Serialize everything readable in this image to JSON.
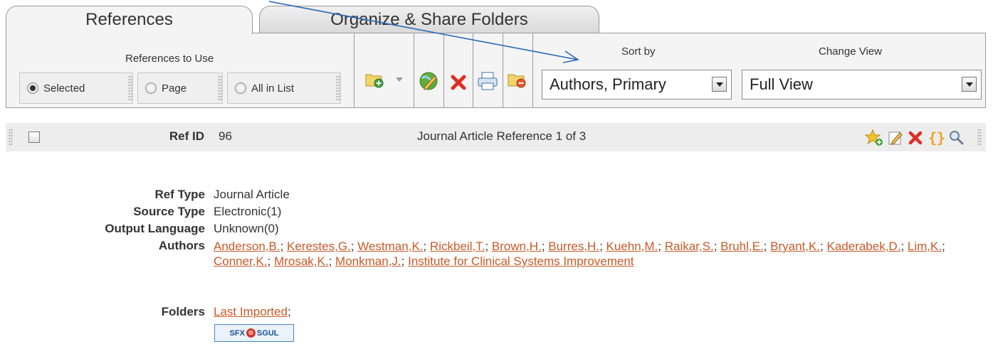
{
  "tabs": [
    {
      "label": "References",
      "active": true
    },
    {
      "label": "Organize & Share Folders",
      "active": false
    }
  ],
  "toolbar": {
    "references_to_use_label": "References to Use",
    "radio_options": [
      {
        "label": "Selected",
        "checked": true
      },
      {
        "label": "Page",
        "checked": false
      },
      {
        "label": "All in List",
        "checked": false
      }
    ],
    "icons": [
      "add-to-folder-icon",
      "dropdown-arrow-icon",
      "edit-globe-icon",
      "delete-icon",
      "print-icon",
      "remove-from-folder-icon"
    ],
    "sort_by": {
      "label": "Sort by",
      "value": "Authors, Primary"
    },
    "change_view": {
      "label": "Change View",
      "value": "Full View"
    }
  },
  "reference": {
    "ref_id_label": "Ref ID",
    "ref_id_value": "96",
    "count_text": "Journal Article Reference 1 of 3",
    "action_icons": [
      "star-icon",
      "edit-icon",
      "delete-icon",
      "braces-icon",
      "search-icon"
    ],
    "fields": [
      {
        "label": "Ref Type",
        "value": "Journal Article"
      },
      {
        "label": "Source Type",
        "value": "Electronic(1)"
      },
      {
        "label": "Output Language",
        "value": "Unknown(0)"
      }
    ],
    "authors_label": "Authors",
    "authors": [
      "Anderson,B.",
      "Kerestes,G.",
      "Westman,K.",
      "Rickbeil,T.",
      "Brown,H.",
      "Burres,H.",
      "Kuehn,M.",
      "Raikar,S.",
      "Bruhl,E.",
      "Bryant,K.",
      "Kaderabek,D.",
      "Lim,K.",
      "Conner,K.",
      "Mrosak,K.",
      "Monkman,J.",
      "Institute for Clinical Systems Improvement"
    ],
    "folders_label": "Folders",
    "folders": [
      "Last Imported"
    ],
    "sfx_button": {
      "text_left": "SFX",
      "text_right": "SGUL"
    }
  },
  "colors": {
    "link": "#c85a28",
    "annotation_arrow": "#2a6ab8"
  }
}
